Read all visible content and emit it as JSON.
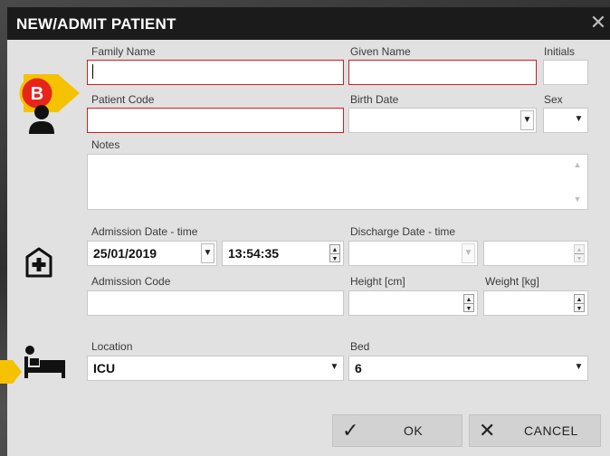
{
  "dialog": {
    "title": "NEW/ADMIT PATIENT",
    "close_glyph": "✕"
  },
  "badge": {
    "letter": "B"
  },
  "icons": [
    "person-icon",
    "hospital-plus-icon",
    "bed-icon"
  ],
  "patient": {
    "family_name": {
      "label": "Family Name",
      "value": ""
    },
    "given_name": {
      "label": "Given Name",
      "value": ""
    },
    "initials": {
      "label": "Initials",
      "value": ""
    },
    "patient_code": {
      "label": "Patient Code",
      "value": ""
    },
    "birth_date": {
      "label": "Birth Date",
      "value": ""
    },
    "sex": {
      "label": "Sex",
      "value": ""
    },
    "notes": {
      "label": "Notes",
      "value": ""
    }
  },
  "admission": {
    "admission_datetime": {
      "label": "Admission Date - time",
      "date": "25/01/2019",
      "time": "13:54:35"
    },
    "discharge_datetime": {
      "label": "Discharge Date - time",
      "date": "",
      "time": ""
    },
    "admission_code": {
      "label": "Admission Code",
      "value": ""
    },
    "height": {
      "label": "Height [cm]",
      "value": ""
    },
    "weight": {
      "label": "Weight [kg]",
      "value": ""
    }
  },
  "location": {
    "location": {
      "label": "Location",
      "value": "ICU"
    },
    "bed": {
      "label": "Bed",
      "value": "6"
    }
  },
  "buttons": {
    "ok": "OK",
    "cancel": "CANCEL"
  },
  "colors": {
    "required_border": "#c92020",
    "badge_fill": "#e8251b",
    "badge_arrow": "#f5c200",
    "titlebar": "#1b1b1b"
  }
}
